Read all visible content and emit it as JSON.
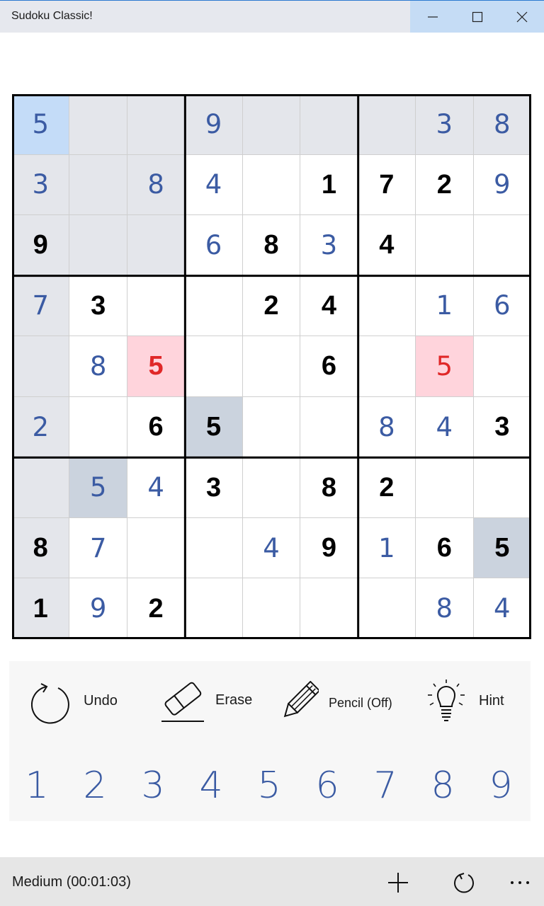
{
  "window": {
    "title": "Sudoku Classic!"
  },
  "board": {
    "rows": [
      [
        {
          "v": "5",
          "t": "user"
        },
        {
          "v": "",
          "t": ""
        },
        {
          "v": "",
          "t": ""
        },
        {
          "v": "9",
          "t": "user"
        },
        {
          "v": "",
          "t": ""
        },
        {
          "v": "",
          "t": ""
        },
        {
          "v": "",
          "t": ""
        },
        {
          "v": "3",
          "t": "user"
        },
        {
          "v": "8",
          "t": "user"
        }
      ],
      [
        {
          "v": "3",
          "t": "user"
        },
        {
          "v": "",
          "t": ""
        },
        {
          "v": "8",
          "t": "user"
        },
        {
          "v": "4",
          "t": "user"
        },
        {
          "v": "",
          "t": ""
        },
        {
          "v": "1",
          "t": "given"
        },
        {
          "v": "7",
          "t": "given"
        },
        {
          "v": "2",
          "t": "given"
        },
        {
          "v": "9",
          "t": "user"
        }
      ],
      [
        {
          "v": "9",
          "t": "given"
        },
        {
          "v": "",
          "t": ""
        },
        {
          "v": "",
          "t": ""
        },
        {
          "v": "6",
          "t": "user"
        },
        {
          "v": "8",
          "t": "given"
        },
        {
          "v": "3",
          "t": "user"
        },
        {
          "v": "4",
          "t": "given"
        },
        {
          "v": "",
          "t": ""
        },
        {
          "v": "",
          "t": ""
        }
      ],
      [
        {
          "v": "7",
          "t": "user"
        },
        {
          "v": "3",
          "t": "given"
        },
        {
          "v": "",
          "t": ""
        },
        {
          "v": "",
          "t": ""
        },
        {
          "v": "2",
          "t": "given"
        },
        {
          "v": "4",
          "t": "given"
        },
        {
          "v": "",
          "t": ""
        },
        {
          "v": "1",
          "t": "user"
        },
        {
          "v": "6",
          "t": "user"
        }
      ],
      [
        {
          "v": "",
          "t": ""
        },
        {
          "v": "8",
          "t": "user"
        },
        {
          "v": "5",
          "t": "given"
        },
        {
          "v": "",
          "t": ""
        },
        {
          "v": "",
          "t": ""
        },
        {
          "v": "6",
          "t": "given"
        },
        {
          "v": "",
          "t": ""
        },
        {
          "v": "5",
          "t": "user"
        },
        {
          "v": "",
          "t": ""
        }
      ],
      [
        {
          "v": "2",
          "t": "user"
        },
        {
          "v": "",
          "t": ""
        },
        {
          "v": "6",
          "t": "given"
        },
        {
          "v": "5",
          "t": "given"
        },
        {
          "v": "",
          "t": ""
        },
        {
          "v": "",
          "t": ""
        },
        {
          "v": "8",
          "t": "user"
        },
        {
          "v": "4",
          "t": "user"
        },
        {
          "v": "3",
          "t": "given"
        }
      ],
      [
        {
          "v": "",
          "t": ""
        },
        {
          "v": "5",
          "t": "user"
        },
        {
          "v": "4",
          "t": "user"
        },
        {
          "v": "3",
          "t": "given"
        },
        {
          "v": "",
          "t": ""
        },
        {
          "v": "8",
          "t": "given"
        },
        {
          "v": "2",
          "t": "given"
        },
        {
          "v": "",
          "t": ""
        },
        {
          "v": "",
          "t": ""
        }
      ],
      [
        {
          "v": "8",
          "t": "given"
        },
        {
          "v": "7",
          "t": "user"
        },
        {
          "v": "",
          "t": ""
        },
        {
          "v": "",
          "t": ""
        },
        {
          "v": "4",
          "t": "user"
        },
        {
          "v": "9",
          "t": "given"
        },
        {
          "v": "1",
          "t": "user"
        },
        {
          "v": "6",
          "t": "given"
        },
        {
          "v": "5",
          "t": "given"
        }
      ],
      [
        {
          "v": "1",
          "t": "given"
        },
        {
          "v": "9",
          "t": "user"
        },
        {
          "v": "2",
          "t": "given"
        },
        {
          "v": "",
          "t": ""
        },
        {
          "v": "",
          "t": ""
        },
        {
          "v": "",
          "t": ""
        },
        {
          "v": "",
          "t": ""
        },
        {
          "v": "8",
          "t": "user"
        },
        {
          "v": "4",
          "t": "user"
        }
      ]
    ],
    "selected_cell": [
      0,
      0
    ],
    "conflict_cells": [
      [
        4,
        2
      ],
      [
        4,
        7
      ]
    ],
    "same_number_cells": [
      [
        5,
        3
      ],
      [
        6,
        1
      ],
      [
        7,
        8
      ]
    ],
    "colors": {
      "selected": "#c4dcf8",
      "highlight": "#e4e6eb",
      "same_number": "#cbd3de",
      "conflict": "#ffd4dc",
      "user_digit": "#3b5ba3",
      "given_digit": "#000000",
      "conflict_digit": "#e02828"
    }
  },
  "tools": {
    "undo": {
      "label": "Undo",
      "icon": "undo-icon"
    },
    "erase": {
      "label": "Erase",
      "icon": "eraser-icon"
    },
    "pencil": {
      "label": "Pencil (Off)",
      "icon": "pencil-icon"
    },
    "hint": {
      "label": "Hint",
      "icon": "lightbulb-icon"
    }
  },
  "numpad": [
    "1",
    "2",
    "3",
    "4",
    "5",
    "6",
    "7",
    "8",
    "9"
  ],
  "status": {
    "text": "Medium (00:01:03)"
  },
  "commands": {
    "new_game_icon": "plus-icon",
    "restart_icon": "refresh-icon",
    "more_icon": "more-icon"
  }
}
